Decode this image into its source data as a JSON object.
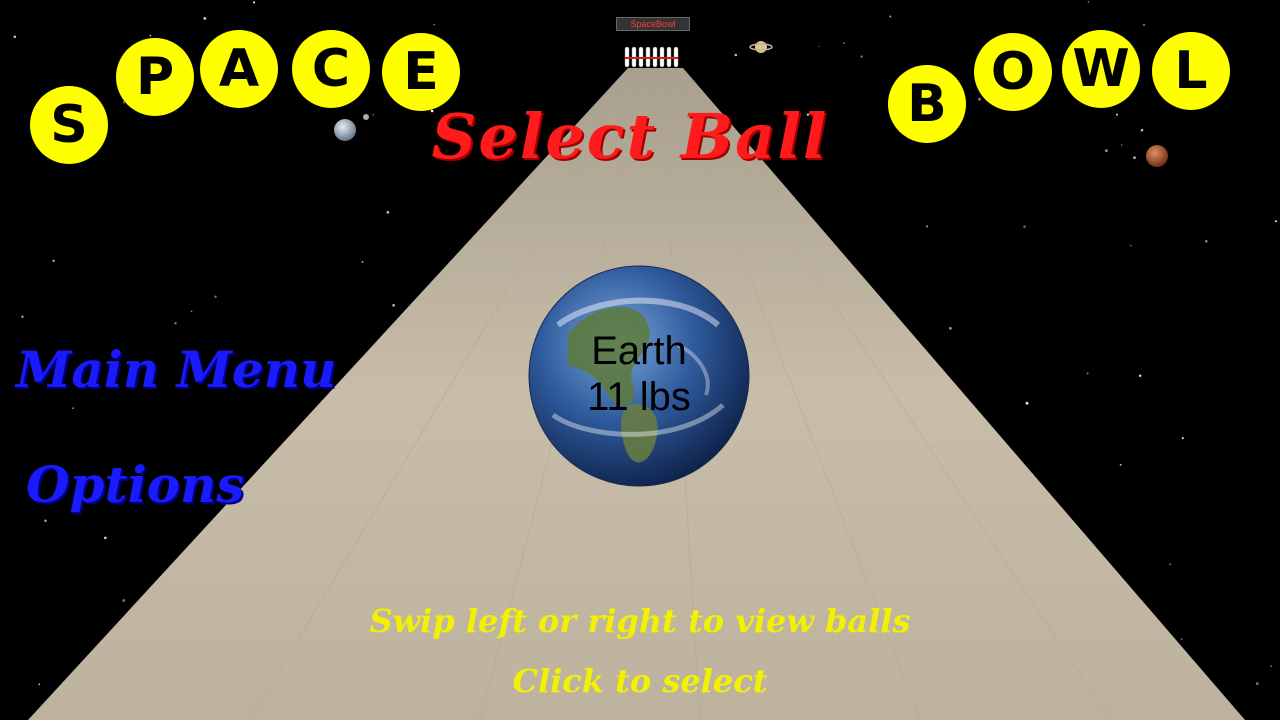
{
  "title": {
    "space_letters": [
      "S",
      "P",
      "A",
      "C",
      "E"
    ],
    "bowl_letters": [
      "B",
      "O",
      "W",
      "L"
    ]
  },
  "lane_sign": "SpaceBowl",
  "screen_title": "Select Ball",
  "menu": {
    "main_menu": "Main Menu",
    "options": "Options"
  },
  "ball": {
    "name": "Earth",
    "weight": "11 lbs"
  },
  "hints": {
    "swipe": "Swip left or right to view balls",
    "click": "Click to select"
  },
  "colors": {
    "title_circle": "#ffff00",
    "select_title": "#ff1b1b",
    "menu_text": "#1a1aff",
    "hint_text": "#f2f200",
    "lane": "#cbbfa8"
  },
  "icons": [
    "earth-ball-icon",
    "moon-icon",
    "saturn-icon",
    "mars-icon",
    "bowling-pins-icon"
  ]
}
